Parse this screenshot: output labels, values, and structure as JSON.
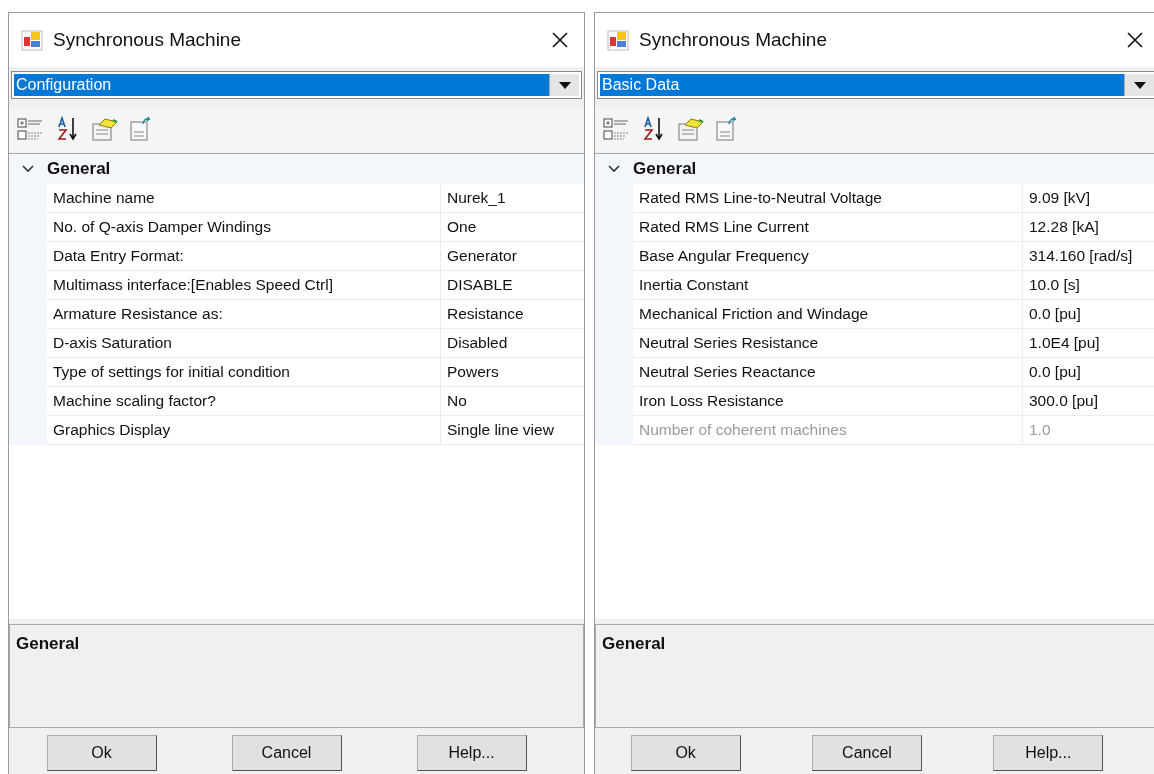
{
  "dialogs": [
    {
      "title": "Synchronous Machine",
      "dropdown": "Configuration",
      "category": {
        "label": "General",
        "expanded": true
      },
      "rows": [
        {
          "name": "Machine name",
          "value": "Nurek_1",
          "disabled": false
        },
        {
          "name": "No. of Q-axis Damper Windings",
          "value": "One",
          "disabled": false
        },
        {
          "name": "Data Entry Format:",
          "value": "Generator",
          "disabled": false
        },
        {
          "name": "Multimass interface:[Enables Speed Ctrl]",
          "value": "DISABLE",
          "disabled": false
        },
        {
          "name": "Armature Resistance as:",
          "value": "Resistance",
          "disabled": false
        },
        {
          "name": "D-axis Saturation",
          "value": "Disabled",
          "disabled": false
        },
        {
          "name": "Type of settings for initial condition",
          "value": "Powers",
          "disabled": false
        },
        {
          "name": "Machine scaling factor?",
          "value": "No",
          "disabled": false
        },
        {
          "name": "Graphics Display",
          "value": "Single line view",
          "disabled": false
        }
      ],
      "description": "General",
      "buttons": [
        "Ok",
        "Cancel",
        "Help..."
      ]
    },
    {
      "title": "Synchronous Machine",
      "dropdown": "Basic Data",
      "category": {
        "label": "General",
        "expanded": true
      },
      "rows": [
        {
          "name": "Rated RMS Line-to-Neutral Voltage",
          "value": "9.09 [kV]",
          "disabled": false
        },
        {
          "name": "Rated RMS Line Current",
          "value": "12.28 [kA]",
          "disabled": false
        },
        {
          "name": "Base Angular Frequency",
          "value": "314.160 [rad/s]",
          "disabled": false
        },
        {
          "name": "Inertia Constant",
          "value": "10.0 [s]",
          "disabled": false
        },
        {
          "name": "Mechanical Friction and Windage",
          "value": "0.0 [pu]",
          "disabled": false
        },
        {
          "name": "Neutral Series Resistance",
          "value": "1.0E4 [pu]",
          "disabled": false
        },
        {
          "name": "Neutral Series Reactance",
          "value": "0.0 [pu]",
          "disabled": false
        },
        {
          "name": "Iron Loss Resistance",
          "value": "300.0 [pu]",
          "disabled": false
        },
        {
          "name": "Number of coherent machines",
          "value": "1.0",
          "disabled": true
        }
      ],
      "description": "General",
      "buttons": [
        "Ok",
        "Cancel",
        "Help..."
      ]
    }
  ]
}
